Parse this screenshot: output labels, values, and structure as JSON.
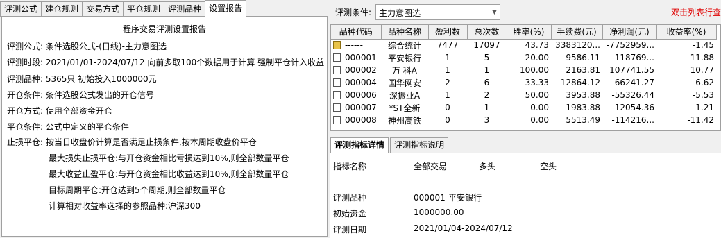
{
  "left_tabs": [
    "评测公式",
    "建仓规则",
    "交易方式",
    "平仓规则",
    "评测品种",
    "设置报告"
  ],
  "report": {
    "title": "程序交易评测设置报告",
    "formula_label": "评测公式:",
    "formula_value": "条件选股公式-(日线)-主力意图选",
    "period_label": "评测时段:",
    "period_value": "2021/01/01-2024/07/12 向前多取100个数据用于计算 强制平仓计入收益",
    "varieties_label": "评测品种:",
    "varieties_value": "5365只 初始投入1000000元",
    "open_cond_label": "开仓条件:",
    "open_cond_value": "条件选股公式发出的开仓信号",
    "open_method_label": "开仓方式:",
    "open_method_value": "使用全部资金开仓",
    "close_cond_label": "平仓条件:",
    "close_cond_value": "公式中定义的平仓条件",
    "stoploss_label": "止损平仓:",
    "stoploss_value": "按当日收盘价计算是否满足止损条件,按本周期收盘价平仓",
    "max_loss": "最大损失止损平仓:与开仓资金相比亏损达到10%,则全部数量平仓",
    "max_gain": "最大收益止盈平仓:与开仓资金相比收益达到10%,则全部数量平仓",
    "target_period": "目标周期平仓:开仓达到5个周期,则全部数量平仓",
    "benchmark": "计算相对收益率选择的参照品种:沪深300"
  },
  "condition": {
    "label": "评测条件:",
    "value": "主力意图选",
    "hint": "双击列表行查"
  },
  "table": {
    "headers": [
      "品种代码",
      "品种名称",
      "盈利数",
      "总次数",
      "胜率(%)",
      "手续费(元)",
      "净利润(元)",
      "收益率(%)"
    ],
    "rows": [
      {
        "code": "------",
        "name": "综合统计",
        "win": "7477",
        "total": "17097",
        "rate": "43.73",
        "fee": "3383120...",
        "profit": "-7752959...",
        "ret": "-1.45",
        "summary": true
      },
      {
        "code": "000001",
        "name": "平安银行",
        "win": "1",
        "total": "5",
        "rate": "20.00",
        "fee": "9586.11",
        "profit": "-118769...",
        "ret": "-11.88"
      },
      {
        "code": "000002",
        "name": "万 科A",
        "win": "1",
        "total": "1",
        "rate": "100.00",
        "fee": "2163.81",
        "profit": "107741.55",
        "ret": "10.77"
      },
      {
        "code": "000004",
        "name": "国华网安",
        "win": "2",
        "total": "6",
        "rate": "33.33",
        "fee": "12864.12",
        "profit": "66241.27",
        "ret": "6.62"
      },
      {
        "code": "000006",
        "name": "深振业A",
        "win": "1",
        "total": "2",
        "rate": "50.00",
        "fee": "3953.88",
        "profit": "-55326.44",
        "ret": "-5.53"
      },
      {
        "code": "000007",
        "name": "*ST全新",
        "win": "0",
        "total": "1",
        "rate": "0.00",
        "fee": "1983.88",
        "profit": "-12054.36",
        "ret": "-1.21"
      },
      {
        "code": "000008",
        "name": "神州高铁",
        "win": "0",
        "total": "3",
        "rate": "0.00",
        "fee": "5513.49",
        "profit": "-114216...",
        "ret": "-11.42"
      }
    ]
  },
  "bottom_tabs": [
    "评测指标详情",
    "评测指标说明"
  ],
  "detail": {
    "col_name": "指标名称",
    "col_all": "全部交易",
    "col_long": "多头",
    "col_short": "空头",
    "variety_label": "评测品种",
    "variety_value": "000001-平安银行",
    "capital_label": "初始资金",
    "capital_value": "1000000.00",
    "date_label": "评测日期",
    "date_value": "2021/01/04-2024/07/12"
  },
  "colors": {
    "hint": "#e00000",
    "summary_icon": "#e8c34a"
  }
}
